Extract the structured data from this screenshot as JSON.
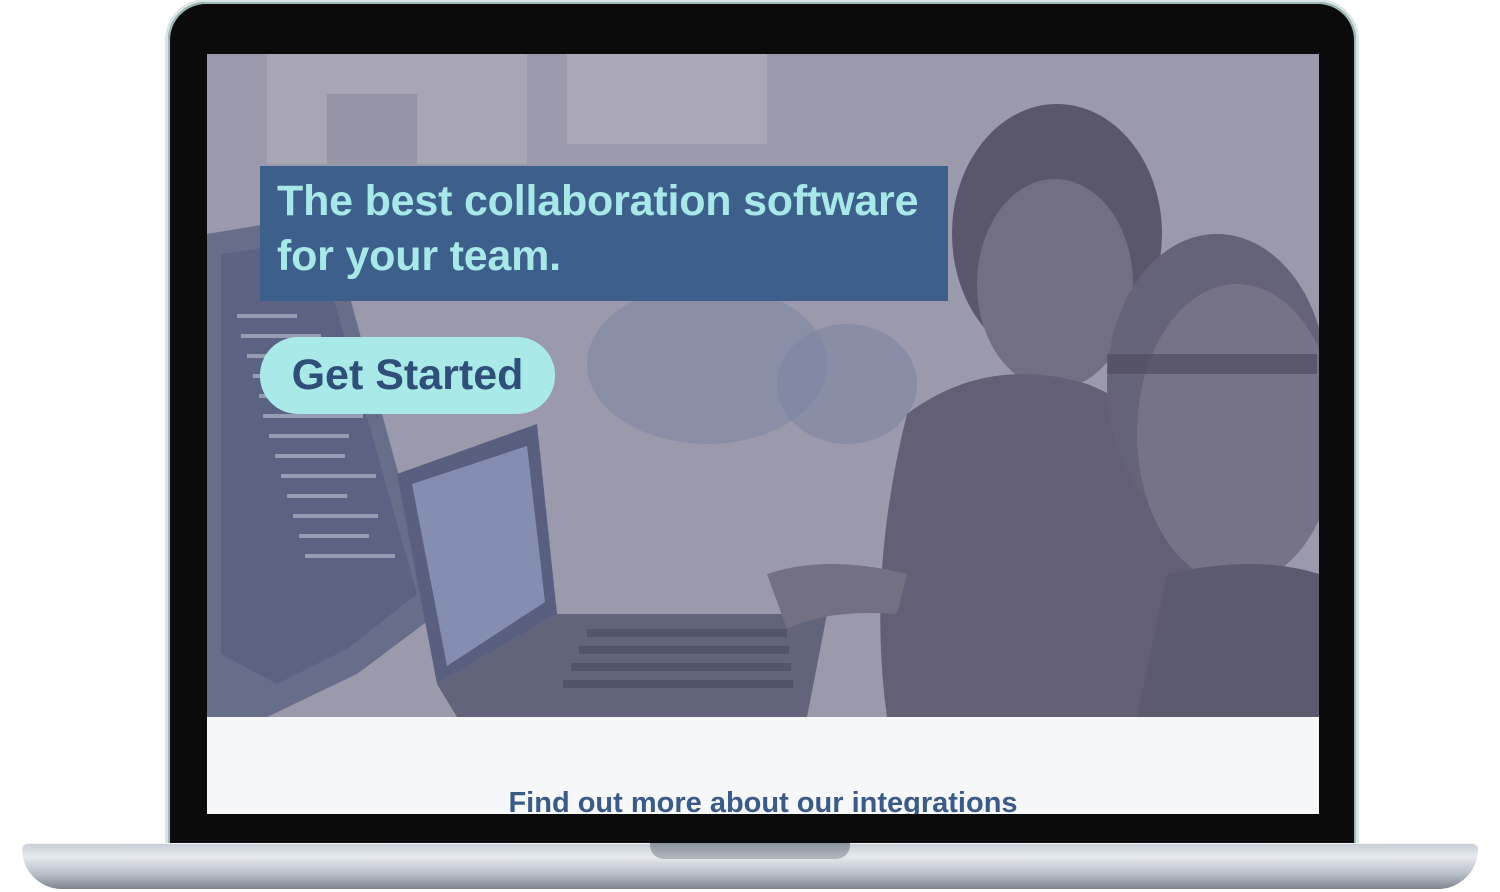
{
  "hero": {
    "headline": "The best collaboration software for your team.",
    "cta_label": "Get Started"
  },
  "section": {
    "heading": "Find out more about our integrations"
  },
  "colors": {
    "headline_bg": "#3d5f8c",
    "headline_text": "#a8e8e8",
    "cta_bg": "#a9e9e8",
    "cta_text": "#2f4f79",
    "section_heading": "#3a5b85"
  },
  "icons": [
    "laptop-device-frame",
    "hero-photo"
  ]
}
